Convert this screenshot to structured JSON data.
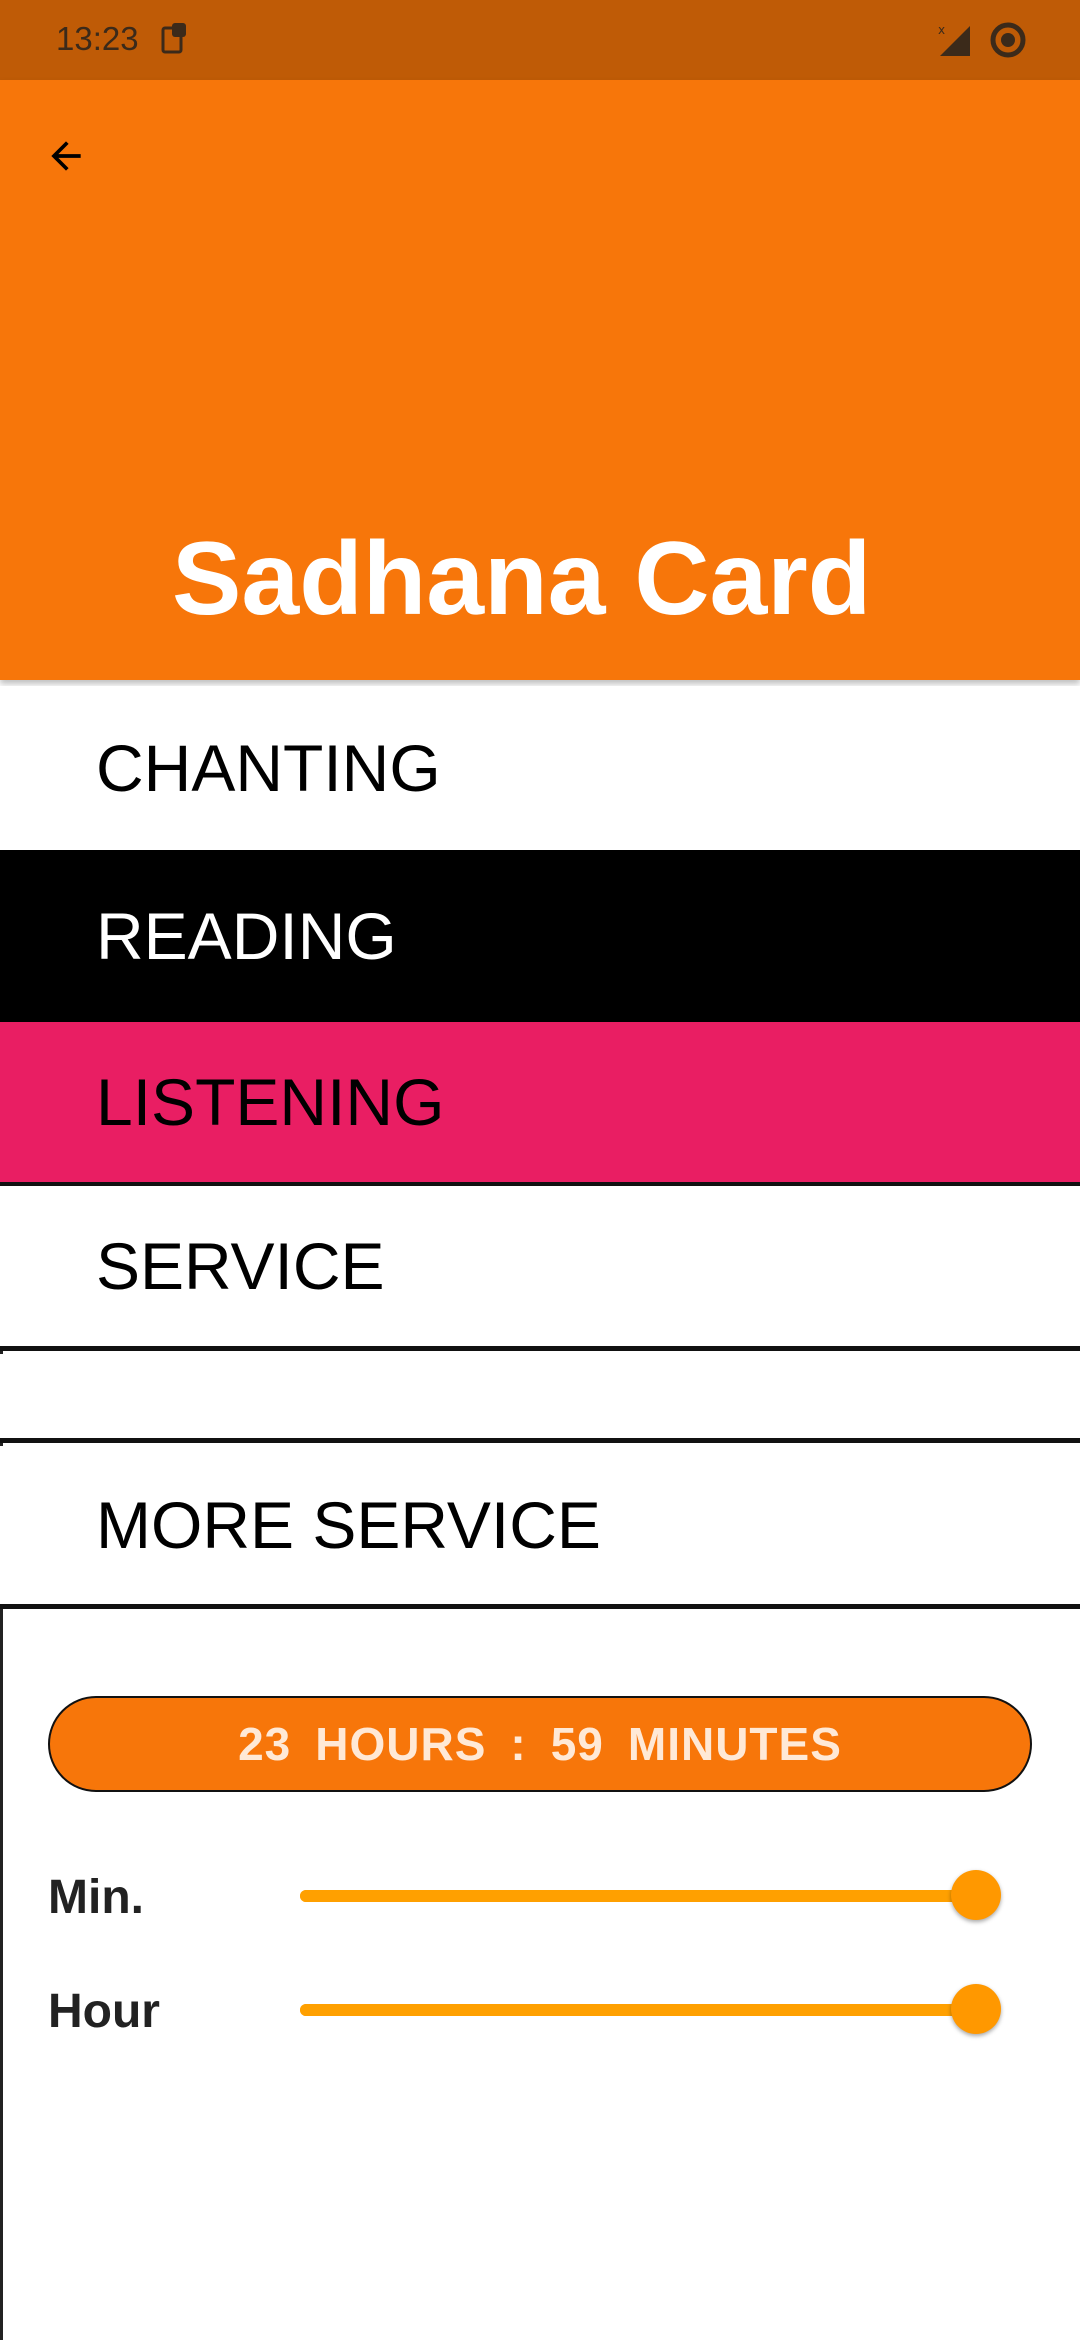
{
  "status_bar": {
    "time": "13:23",
    "icons": [
      "notification-icon",
      "signal-icon",
      "record-icon"
    ]
  },
  "app_bar": {
    "title": "Sadhana Card",
    "back_icon": "arrow-back-icon",
    "color": "#F7760A"
  },
  "menu": {
    "items": [
      {
        "label": "CHANTING"
      },
      {
        "label": "READING"
      },
      {
        "label": "LISTENING"
      },
      {
        "label": "SERVICE"
      },
      {
        "label": ""
      },
      {
        "label": "MORE SERVICE"
      }
    ]
  },
  "time_display": {
    "hours": "23",
    "hours_label": "HOURS",
    "separator": ":",
    "minutes": "59",
    "minutes_label": "MINUTES"
  },
  "sliders": {
    "minutes": {
      "label": "Min.",
      "value": 59,
      "max": 59
    },
    "hours": {
      "label": "Hour",
      "value": 23,
      "max": 23
    },
    "accent_color": "#FF9800"
  }
}
